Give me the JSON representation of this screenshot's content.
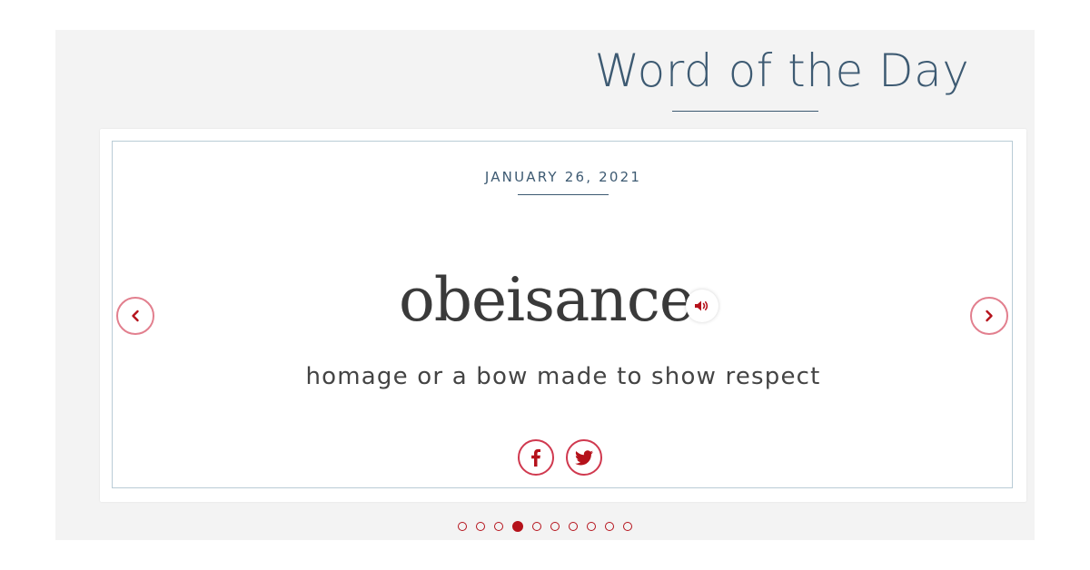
{
  "header": {
    "title": "Word of the Day"
  },
  "card": {
    "date": "JANUARY 26, 2021",
    "word": "obeisance",
    "definition": "homage or a bow made to show respect"
  },
  "icons": {
    "audio": "speaker-icon",
    "prev": "chevron-left-icon",
    "next": "chevron-right-icon",
    "facebook": "facebook-icon",
    "twitter": "twitter-icon"
  },
  "pagination": {
    "count": 10,
    "active_index": 3
  },
  "colors": {
    "title": "#3d5a72",
    "accent": "#b5121b",
    "arrow_border": "#e27f8e",
    "panel_bg": "#f3f3f3",
    "card_border": "#b9ccd6"
  }
}
